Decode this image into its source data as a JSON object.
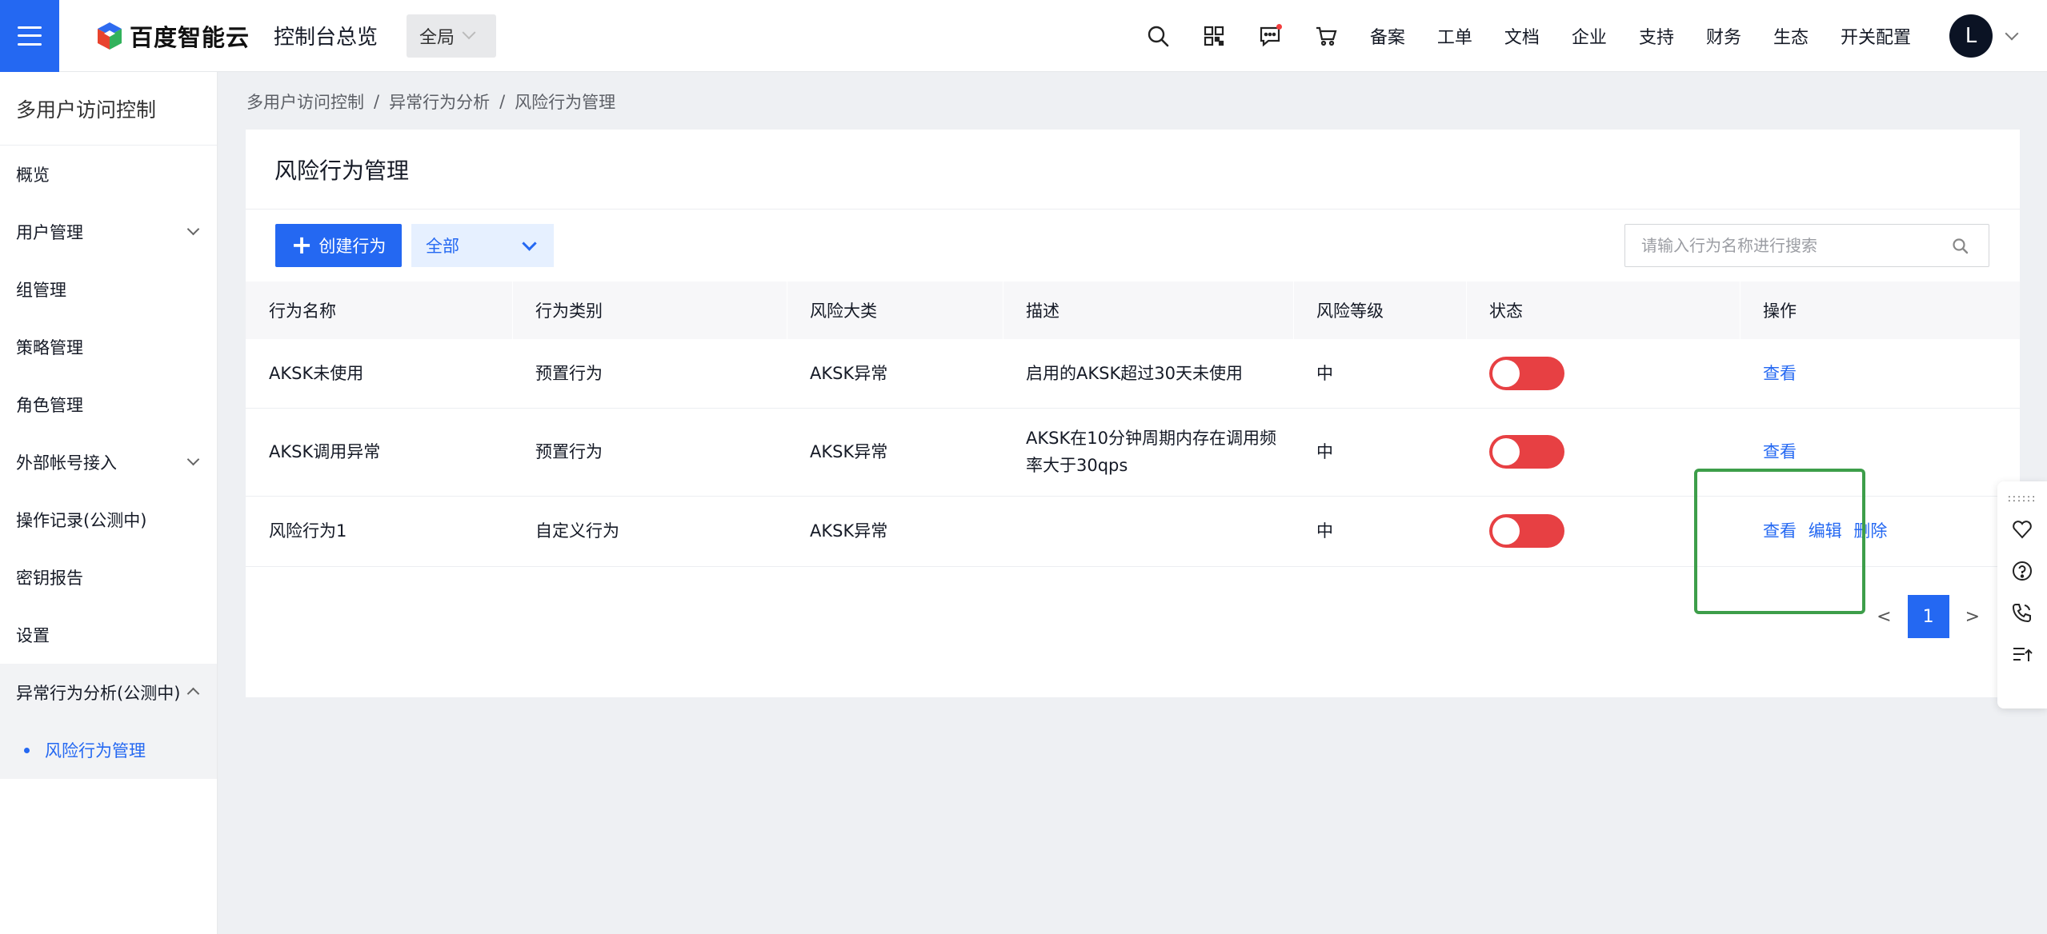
{
  "topbar": {
    "logo_text": "百度智能云",
    "console_title": "控制台总览",
    "region": "全局",
    "nav": [
      "备案",
      "工单",
      "文档",
      "企业",
      "支持",
      "财务",
      "生态",
      "开关配置"
    ],
    "avatar_letter": "L",
    "icons": [
      "search-icon",
      "qrcode-icon",
      "message-icon",
      "cart-icon"
    ]
  },
  "sidebar": {
    "title": "多用户访问控制",
    "items": [
      {
        "label": "概览"
      },
      {
        "label": "用户管理"
      },
      {
        "label": "组管理"
      },
      {
        "label": "策略管理"
      },
      {
        "label": "角色管理"
      },
      {
        "label": "外部帐号接入"
      },
      {
        "label": "操作记录(公测中)"
      },
      {
        "label": "密钥报告"
      },
      {
        "label": "设置"
      },
      {
        "label": "异常行为分析(公测中)"
      }
    ],
    "sub_item": "风险行为管理"
  },
  "breadcrumb": [
    "多用户访问控制",
    "异常行为分析",
    "风险行为管理"
  ],
  "page": {
    "title": "风险行为管理",
    "create_button": "创建行为",
    "filter_value": "全部",
    "search_placeholder": "请输入行为名称进行搜索"
  },
  "table": {
    "headers": [
      "行为名称",
      "行为类别",
      "风险大类",
      "描述",
      "风险等级",
      "状态",
      "操作"
    ],
    "rows": [
      {
        "name": "AKSK未使用",
        "category": "预置行为",
        "risk_type": "AKSK异常",
        "desc": "启用的AKSK超过30天未使用",
        "level": "中",
        "enabled": false,
        "actions": [
          "查看"
        ]
      },
      {
        "name": "AKSK调用异常",
        "category": "预置行为",
        "risk_type": "AKSK异常",
        "desc": "AKSK在10分钟周期内存在调用频率大于30qps",
        "level": "中",
        "enabled": false,
        "actions": [
          "查看"
        ]
      },
      {
        "name": "风险行为1",
        "category": "自定义行为",
        "risk_type": "AKSK异常",
        "desc": "",
        "level": "中",
        "enabled": false,
        "actions": [
          "查看",
          "编辑",
          "删除"
        ]
      }
    ]
  },
  "pagination": {
    "prev": "<",
    "current": "1",
    "next": ">"
  },
  "colors": {
    "primary": "#2468f2",
    "toggle_off": "#e74043",
    "highlight": "#3d9e4a"
  }
}
